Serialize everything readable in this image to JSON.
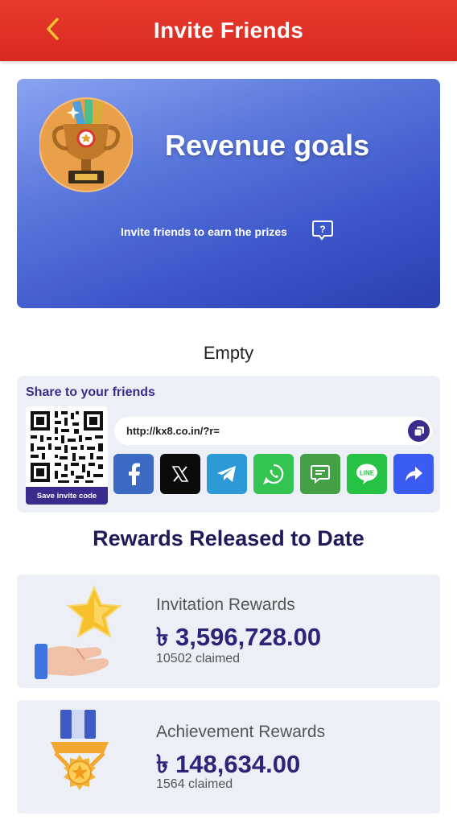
{
  "header": {
    "title": "Invite Friends",
    "back_icon": "chevron-left-icon"
  },
  "banner": {
    "title": "Revenue goals",
    "subtitle": "Invite friends to earn the prizes",
    "help_icon": "question-bubble-icon"
  },
  "empty_text": "Empty",
  "share": {
    "title": "Share to your friends",
    "save_label": "Save invite code",
    "link_value": "http://kx8.co.in/?r=",
    "buttons": [
      {
        "name": "facebook",
        "color": "#3b69c4"
      },
      {
        "name": "x",
        "color": "#0a0a0a"
      },
      {
        "name": "telegram",
        "color": "#2d9ad8"
      },
      {
        "name": "whatsapp",
        "color": "#34c452"
      },
      {
        "name": "sms",
        "color": "#43a047"
      },
      {
        "name": "line",
        "color": "#25c244"
      },
      {
        "name": "share",
        "color": "#3a5cf2"
      }
    ]
  },
  "rewards": {
    "heading": "Rewards Released to Date",
    "items": [
      {
        "title": "Invitation Rewards",
        "amount": "৳ 3,596,728.00",
        "claimed": "10502 claimed"
      },
      {
        "title": "Achievement Rewards",
        "amount": "৳ 148,634.00",
        "claimed": "1564 claimed"
      }
    ]
  },
  "colors": {
    "header_red": "#e03428",
    "brand_purple": "#3a2b8c",
    "banner_blue": "#4a66d4"
  }
}
